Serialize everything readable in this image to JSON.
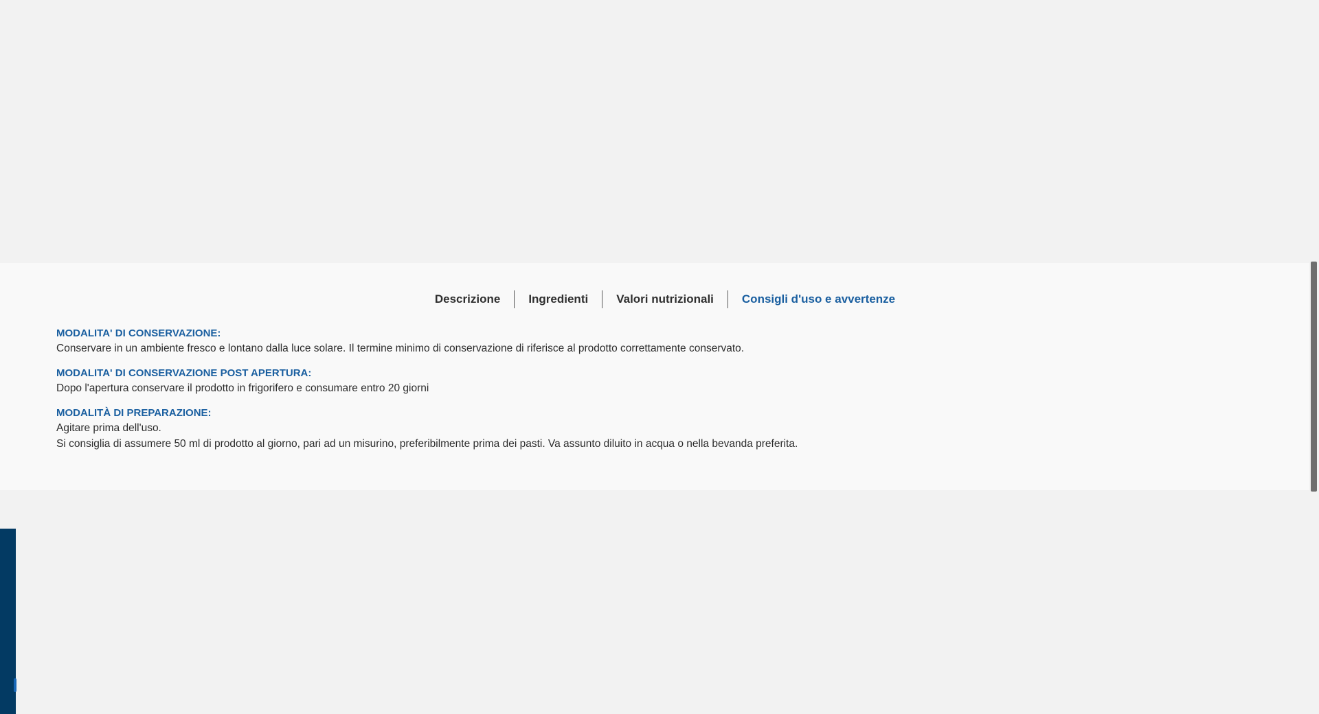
{
  "tabs": [
    {
      "label": "Descrizione",
      "active": false
    },
    {
      "label": "Ingredienti",
      "active": false
    },
    {
      "label": "Valori nutrizionali",
      "active": false
    },
    {
      "label": "Consigli d'uso e avvertenze",
      "active": true
    }
  ],
  "sections": [
    {
      "heading": "MODALITA' DI CONSERVAZIONE:",
      "lines": [
        "Conservare in un ambiente fresco e lontano dalla luce solare. Il termine minimo di conservazione di riferisce al prodotto correttamente conservato."
      ]
    },
    {
      "heading": "MODALITA' DI CONSERVAZIONE POST APERTURA:",
      "lines": [
        "Dopo l'apertura conservare il prodotto in frigorifero e consumare entro 20 giorni"
      ]
    },
    {
      "heading": "MODALITÀ DI PREPARAZIONE:",
      "lines": [
        "Agitare prima dell'uso.",
        "Si consiglia di assumere 50 ml di prodotto al giorno, pari ad un misurino, preferibilmente prima dei pasti. Va assunto diluito in acqua o nella bevanda preferita."
      ]
    }
  ],
  "colors": {
    "accent": "#1a5fa0",
    "text": "#2c2c2c",
    "page_bg": "#f2f2f2",
    "panel_bg": "#f9f9f9",
    "side_bar": "#033a63"
  }
}
